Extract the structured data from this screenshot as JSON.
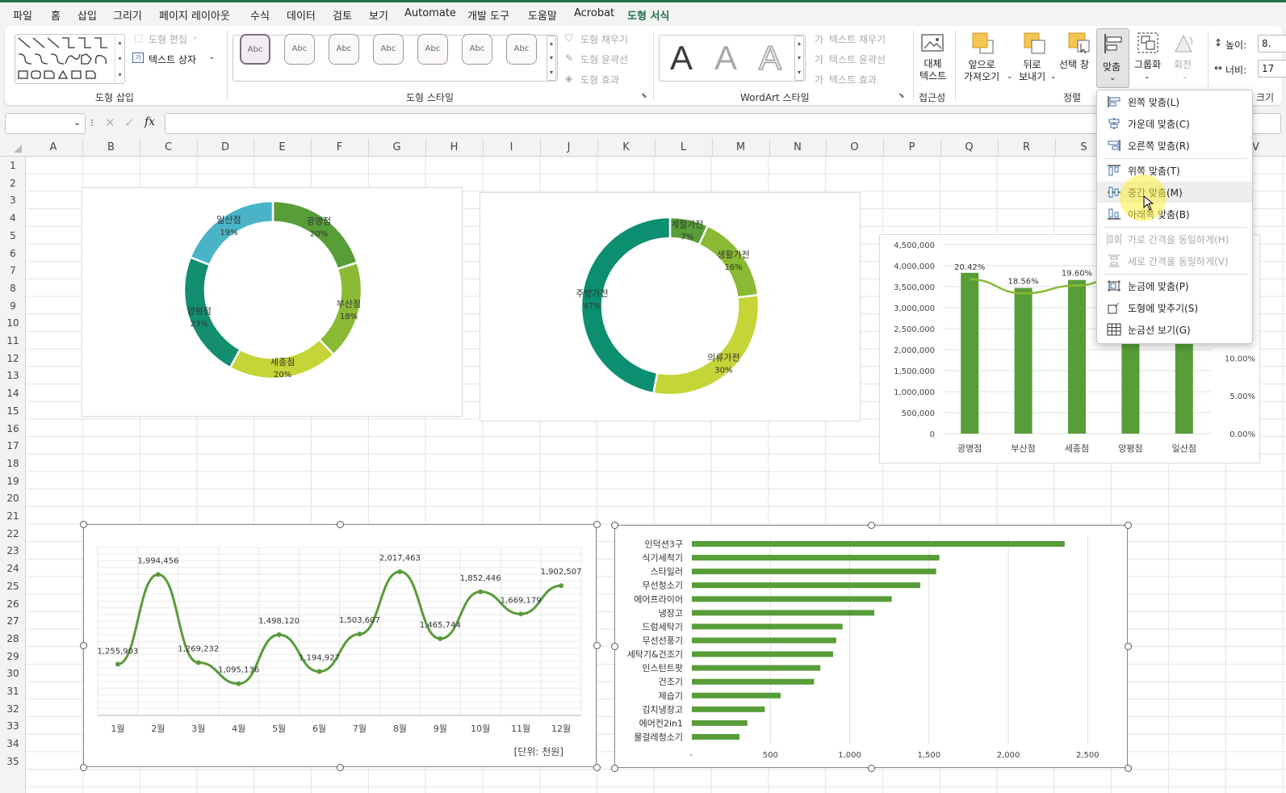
{
  "menu": {
    "tabs": [
      "파일",
      "홈",
      "삽입",
      "그리기",
      "페이지 레이아웃",
      "수식",
      "데이터",
      "검토",
      "보기",
      "Automate",
      "개발 도구",
      "도움말",
      "Acrobat",
      "도형 서식"
    ],
    "active": "도형 서식"
  },
  "ribbon": {
    "insert_shapes": {
      "edit_shape": "도형 편집",
      "text_box": "텍스트 상자",
      "group_label": "도형 삽입"
    },
    "shape_styles": {
      "swatch": "Abc",
      "fill": "도형 채우기",
      "outline": "도형 윤곽선",
      "effects": "도형 효과",
      "group_label": "도형 스타일"
    },
    "wordart": {
      "letter": "A",
      "fill": "텍스트 채우기",
      "outline": "텍스트 윤곽선",
      "effects": "텍스트 효과",
      "group_label": "WordArt 스타일"
    },
    "accessibility": {
      "alt_text_1": "대체",
      "alt_text_2": "텍스트",
      "group_label": "접근성"
    },
    "arrange": {
      "bring_forward_1": "앞으로",
      "bring_forward_2": "가져오기",
      "send_backward_1": "뒤로",
      "send_backward_2": "보내기",
      "selection_pane": "선택 창",
      "align": "맞춤",
      "group": "그룹화",
      "rotate": "회전",
      "group_label": "정렬"
    },
    "size": {
      "height_label": "높이:",
      "height_value": "8.",
      "width_label": "너비:",
      "width_value": "17",
      "group_label": "크기"
    }
  },
  "formula_bar": {
    "fx": "fx"
  },
  "columns": [
    "A",
    "B",
    "C",
    "D",
    "E",
    "F",
    "G",
    "H",
    "I",
    "J",
    "K",
    "L",
    "M",
    "N",
    "O",
    "P",
    "Q",
    "R",
    "S",
    "T",
    "U",
    "V"
  ],
  "rows": [
    "1",
    "2",
    "3",
    "4",
    "5",
    "6",
    "7",
    "8",
    "9",
    "10",
    "11",
    "12",
    "13",
    "14",
    "15",
    "16",
    "17",
    "18",
    "19",
    "20",
    "21",
    "22",
    "23",
    "24",
    "25",
    "26",
    "27",
    "28",
    "29",
    "30",
    "31",
    "32",
    "33",
    "34",
    "35"
  ],
  "align_menu": {
    "items": [
      {
        "label": "왼쪽 맞춤(L)",
        "enabled": true
      },
      {
        "label": "가운데 맞춤(C)",
        "enabled": true
      },
      {
        "label": "오른쪽 맞춤(R)",
        "enabled": true
      },
      {
        "label": "위쪽 맞춤(T)",
        "enabled": true
      },
      {
        "label": "중간 맞춤(M)",
        "enabled": true,
        "highlighted": true
      },
      {
        "label": "아래쪽 맞춤(B)",
        "enabled": true
      },
      {
        "label": "가로 간격을 동일하게(H)",
        "enabled": false
      },
      {
        "label": "세로 간격을 동일하게(V)",
        "enabled": false
      },
      {
        "label": "눈금에 맞춤(P)",
        "enabled": true
      },
      {
        "label": "도형에 맞추기(S)",
        "enabled": true
      },
      {
        "label": "눈금선 보기(G)",
        "enabled": true
      }
    ]
  },
  "colors": {
    "accent": "#1e7145",
    "bar": "#579d38",
    "line": "#5a9a3a"
  },
  "chart_data": [
    {
      "type": "pie",
      "title": "",
      "donut": true,
      "slices": [
        {
          "label": "광명점",
          "value": 20,
          "pct": "20%",
          "color": "#579d38"
        },
        {
          "label": "부산점",
          "value": 18,
          "pct": "18%",
          "color": "#8ab934"
        },
        {
          "label": "세종점",
          "value": 20,
          "pct": "20%",
          "color": "#c5d436"
        },
        {
          "label": "양평점",
          "value": 23,
          "pct": "23%",
          "color": "#138f70"
        },
        {
          "label": "일산점",
          "value": 19,
          "pct": "19%",
          "color": "#49b4c7"
        }
      ]
    },
    {
      "type": "pie",
      "title": "",
      "donut": true,
      "slices": [
        {
          "label": "계절가전",
          "value": 7,
          "pct": "7%",
          "color": "#579d38"
        },
        {
          "label": "생활가전",
          "value": 16,
          "pct": "16%",
          "color": "#8ab934"
        },
        {
          "label": "의류가전",
          "value": 30,
          "pct": "30%",
          "color": "#c5d436"
        },
        {
          "label": "주방가전",
          "value": 47,
          "pct": "47%",
          "color": "#0b8f70"
        }
      ]
    },
    {
      "type": "bar",
      "title": "",
      "categories": [
        "광명점",
        "부산점",
        "세종점",
        "양평점",
        "일산점"
      ],
      "series": [
        {
          "type": "bar",
          "values": [
            3830000,
            3470000,
            3660000,
            4000000,
            3550000
          ]
        },
        {
          "type": "line",
          "axis": "secondary",
          "values": [
            20.42,
            18.56,
            19.6,
            21.5,
            19.9
          ],
          "labels": [
            "20.42%",
            "18.56%",
            "19.60%"
          ]
        }
      ],
      "ylim": [
        0,
        4500000
      ],
      "yticks": [
        "4,500,000",
        "4,000,000",
        "3,500,000",
        "3,000,000",
        "2,500,000",
        "2,000,000",
        "1,500,000",
        "1,000,000",
        "500,000",
        "0"
      ],
      "y2ticks": [
        "10.00%",
        "5.00%",
        "0.00%"
      ]
    },
    {
      "type": "line",
      "title": "",
      "smooth": true,
      "categories": [
        "1월",
        "2월",
        "3월",
        "4월",
        "5월",
        "6월",
        "7월",
        "8월",
        "9월",
        "10월",
        "11월",
        "12월"
      ],
      "values": [
        1255903,
        1994456,
        1269232,
        1095136,
        1498120,
        1194927,
        1503607,
        2017463,
        1465744,
        1852446,
        1669179,
        1902507
      ],
      "labels": [
        "1,255,903",
        "1,994,456",
        "1,269,232",
        "1,095,136",
        "1,498,120",
        "1,194,927",
        "1,503,607",
        "2,017,463",
        "1,465,744",
        "1,852,446",
        "1,669,179",
        "1,902,507"
      ],
      "ylim": [
        0,
        2300000
      ],
      "note": "[단위: 천원]"
    },
    {
      "type": "bar",
      "orientation": "horizontal",
      "title": "",
      "categories": [
        "인덕션3구",
        "식기세척기",
        "스타일러",
        "무선청소기",
        "에어프라이어",
        "냉장고",
        "드럼세탁기",
        "무선선풍기",
        "세탁기&건조기",
        "인스턴트팟",
        "건조기",
        "제습기",
        "김치냉장고",
        "에어컨2in1",
        "물걸레청소기"
      ],
      "values": [
        2350,
        1560,
        1540,
        1440,
        1260,
        1150,
        950,
        910,
        890,
        810,
        770,
        560,
        460,
        350,
        300
      ],
      "xlim": [
        0,
        2600
      ],
      "xticks": [
        "-",
        "500",
        "1,000",
        "1,500",
        "2,000",
        "2,500"
      ]
    }
  ]
}
